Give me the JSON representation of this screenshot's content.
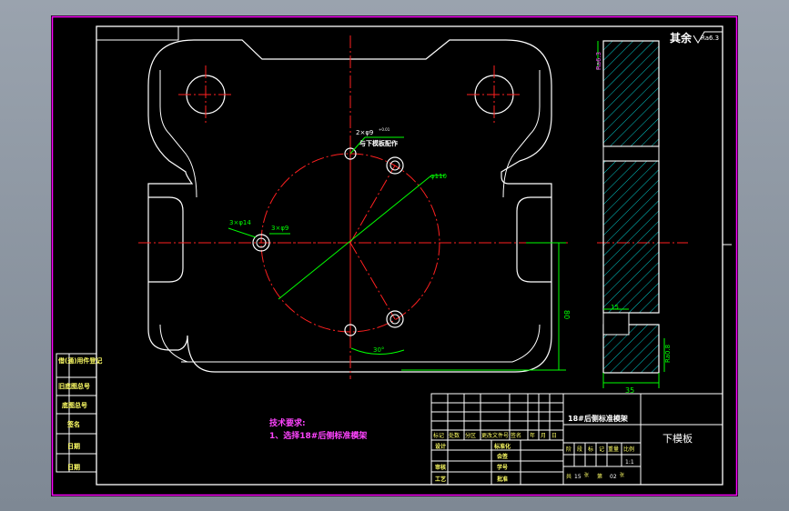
{
  "drawing": {
    "surface_finish": {
      "word": "其余",
      "value": "Ra6.3"
    },
    "title_block": {
      "title": "18#后侧标准模架",
      "part_name": "下模板",
      "revision_headers": [
        "标记",
        "处数",
        "分区",
        "更改文件号",
        "签名",
        "年",
        "月",
        "日"
      ],
      "roles": {
        "design": "设计",
        "review": "审核",
        "process": "工艺"
      },
      "stage_labels": [
        "阶",
        "段",
        "标",
        "记",
        "重量",
        "比例"
      ],
      "scale": "1:1",
      "mid_labels": {
        "std": "标准化",
        "check": "会签",
        "code": "学号",
        "approve": "批准"
      },
      "sheets": {
        "total_prefix": "共",
        "total": "15",
        "unit": "张",
        "index_prefix": "第",
        "index": "02",
        "index_unit": "张"
      }
    },
    "left_column": [
      "借(通)用件登记",
      "旧底图总号",
      "底图总号",
      "签名",
      "日期",
      "日期"
    ],
    "tech_requirements": {
      "heading": "技术要求:",
      "item1": "1、选择18#后侧标准模架"
    },
    "dimensions": {
      "hole_callout_1": "2×φ9",
      "hole_callout_1_tol": "+0.01",
      "hole_note": "与下模板配作",
      "hole_callout_2": "3×φ14",
      "hole_callout_3": "3×φ9",
      "pitch_diameter": "φ110",
      "height_dim": "80",
      "angle": "30°",
      "top_roughness": "Ra6.3",
      "side_roughness": "Ra0.8",
      "counterbore": "15",
      "thickness": "35"
    }
  },
  "colors": {
    "background": "#000000",
    "frame": "#ffffff",
    "border": "#ff00ff",
    "centerline": "#ff2020",
    "dimension": "#00ff00",
    "hatch": "#00c8c8",
    "text_yellow": "#ffff66",
    "text_magenta": "#ff44ff"
  }
}
